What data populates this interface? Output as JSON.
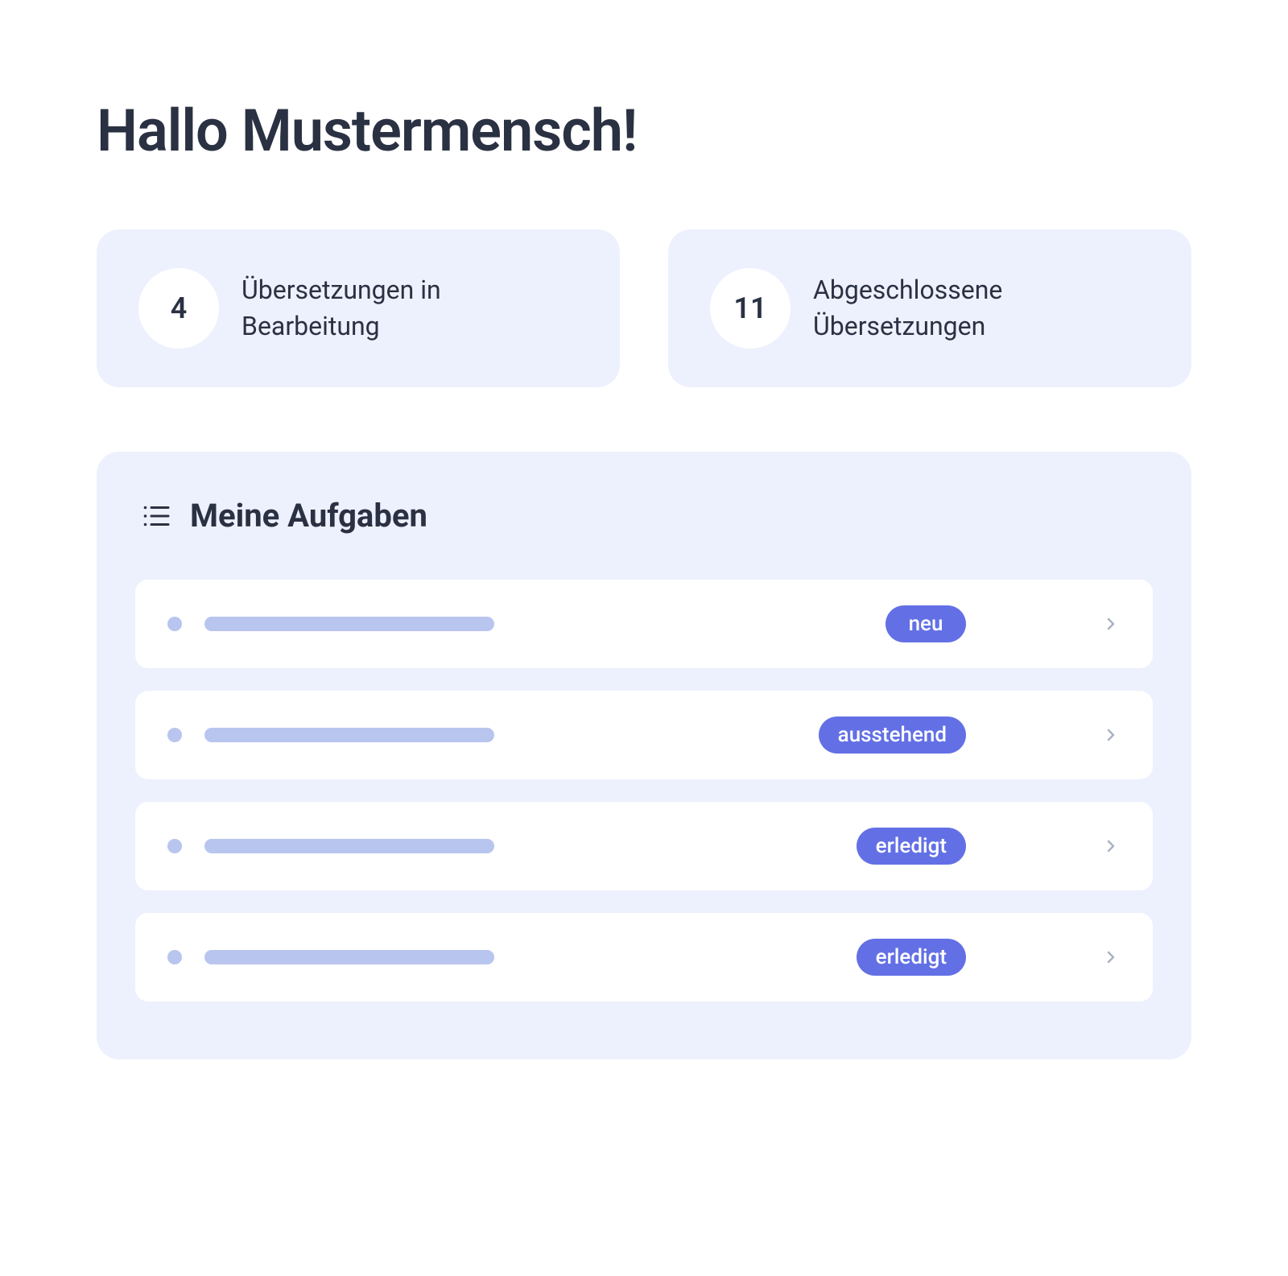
{
  "header": {
    "greeting": "Hallo Mustermensch!"
  },
  "stats": [
    {
      "count": "4",
      "label": "Übersetzungen in Bearbeitung"
    },
    {
      "count": "11",
      "label": "Abgeschlossene Übersetzungen"
    }
  ],
  "tasks": {
    "title": "Meine Aufgaben",
    "items": [
      {
        "status": "neu"
      },
      {
        "status": "ausstehend"
      },
      {
        "status": "erledigt"
      },
      {
        "status": "erledigt"
      }
    ]
  },
  "colors": {
    "panel_bg": "#edf1fd",
    "accent": "#6370e5",
    "placeholder": "#b8c5ee",
    "text": "#2a3142"
  }
}
